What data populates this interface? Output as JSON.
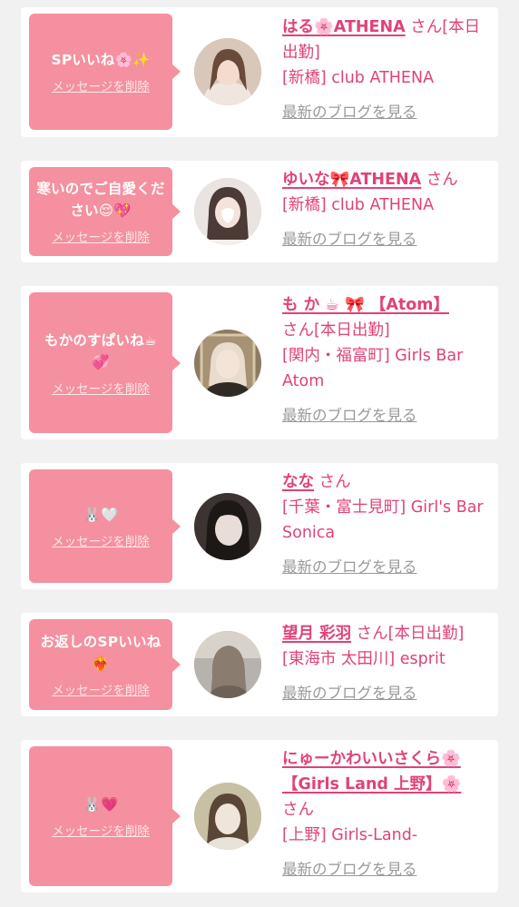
{
  "cards": [
    {
      "bubble_message": "SPいいね🌸✨",
      "delete_label": "メッセージを削除",
      "name": "はる🌸ATHENA",
      "honorific": "さん",
      "status": "[本日出勤]",
      "shop": "[新橋] club ATHENA",
      "blog_label": "最新のブログを見る",
      "avatar_colors": [
        "#d9c7b9",
        "#f1e6df",
        "#6a4a3a"
      ]
    },
    {
      "bubble_message": "寒いのでご自愛ください😌💖",
      "delete_label": "メッセージを削除",
      "name": "ゆいな🎀ATHENA",
      "honorific": "さん",
      "status": "",
      "shop": "[新橋] club ATHENA",
      "blog_label": "最新のブログを見る",
      "avatar_colors": [
        "#e9e4e1",
        "#f6efeb",
        "#4b3a35"
      ]
    },
    {
      "bubble_message": "もかのすぱいね☕💞",
      "delete_label": "メッセージを削除",
      "name": "も か ☕ 🎀 【Atom】",
      "honorific": "さん",
      "status": "[本日出勤]",
      "shop": "[関内・福富町] Girls Bar Atom",
      "blog_label": "最新のブログを見る",
      "avatar_colors": [
        "#8c7a63",
        "#e9dccd",
        "#2f2a26"
      ]
    },
    {
      "bubble_message": "🐰🤍",
      "delete_label": "メッセージを削除",
      "name": "なな",
      "honorific": "さん",
      "status": "",
      "shop": "[千葉・富士見町] Girl's Bar Sonica",
      "blog_label": "最新のブログを見る",
      "avatar_colors": [
        "#3b3432",
        "#e8ddd7",
        "#1c1816"
      ]
    },
    {
      "bubble_message": "お返しのSPいいね❤️‍🔥",
      "delete_label": "メッセージを削除",
      "name": "望月 彩羽",
      "honorific": "さん",
      "status": "[本日出勤]",
      "shop": "[東海市 太田川] esprit",
      "blog_label": "最新のブログを見る",
      "avatar_colors": [
        "#b6b2ad",
        "#d8d2cb",
        "#8a7c6f"
      ]
    },
    {
      "bubble_message": "🐰💗",
      "delete_label": "メッセージを削除",
      "name": "にゅーかわいいさくら🌸【Girls Land 上野】🌸",
      "honorific": "さん",
      "status": "",
      "shop": "[上野] Girls-Land-",
      "blog_label": "最新のブログを見る",
      "avatar_colors": [
        "#c8c0a4",
        "#f0e5da",
        "#5a4636"
      ]
    }
  ]
}
